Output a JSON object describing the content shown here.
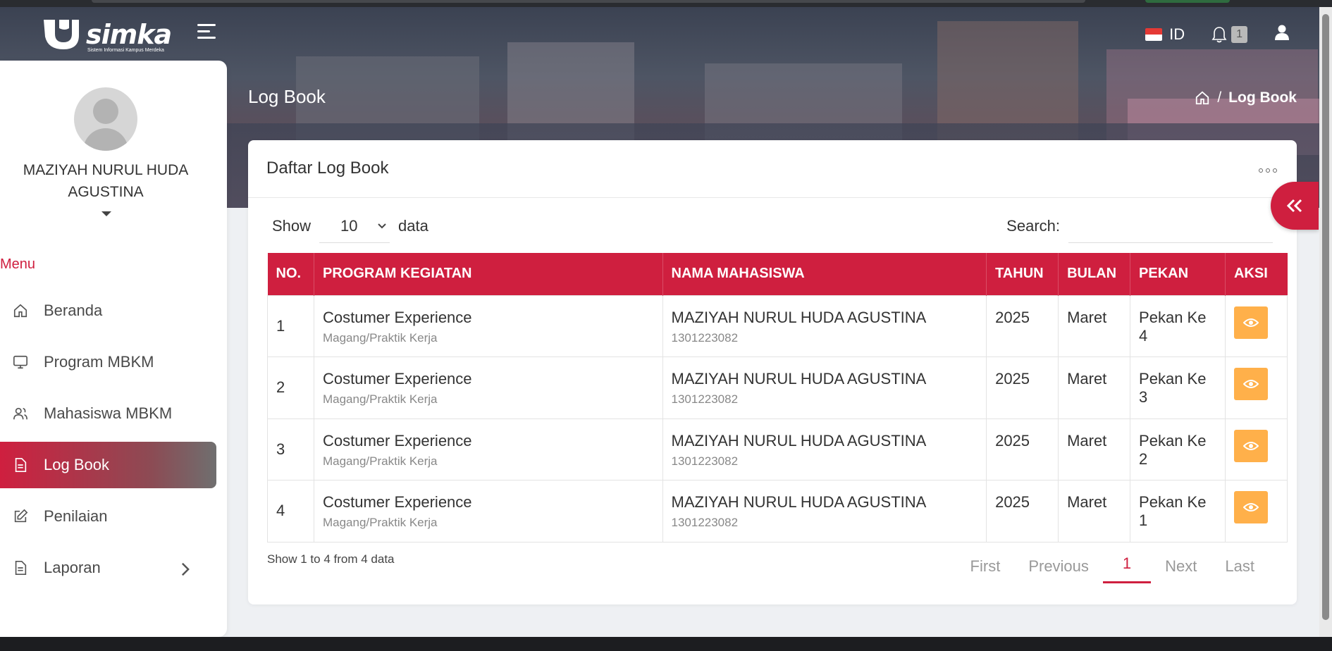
{
  "brand": {
    "name": "simka",
    "tagline": "Sistem Informasi Kampus Merdeka"
  },
  "topbar": {
    "language": "ID",
    "notification_count": "1"
  },
  "page": {
    "title": "Log Book",
    "breadcrumb": "Log Book"
  },
  "user": {
    "name": "MAZIYAH NURUL HUDA AGUSTINA"
  },
  "sidebar": {
    "menu_title": "Menu",
    "items": [
      {
        "label": "Beranda",
        "icon": "home-icon"
      },
      {
        "label": "Program MBKM",
        "icon": "monitor-icon"
      },
      {
        "label": "Mahasiswa MBKM",
        "icon": "users-icon"
      },
      {
        "label": "Log Book",
        "icon": "document-icon",
        "active": true
      },
      {
        "label": "Penilaian",
        "icon": "edit-icon"
      },
      {
        "label": "Laporan",
        "icon": "document-icon"
      }
    ]
  },
  "card": {
    "title": "Daftar Log Book"
  },
  "controls": {
    "show_label": "Show",
    "page_size": "10",
    "data_label": "data",
    "search_label": "Search:"
  },
  "table": {
    "columns": [
      "NO.",
      "PROGRAM KEGIATAN",
      "NAMA MAHASISWA",
      "TAHUN",
      "BULAN",
      "PEKAN",
      "AKSI"
    ],
    "rows": [
      {
        "no": "1",
        "program": "Costumer Experience",
        "program_type": "Magang/Praktik Kerja",
        "name": "MAZIYAH NURUL HUDA AGUSTINA",
        "nim": "1301223082",
        "year": "2025",
        "month": "Maret",
        "week": "Pekan Ke 4"
      },
      {
        "no": "2",
        "program": "Costumer Experience",
        "program_type": "Magang/Praktik Kerja",
        "name": "MAZIYAH NURUL HUDA AGUSTINA",
        "nim": "1301223082",
        "year": "2025",
        "month": "Maret",
        "week": "Pekan Ke 3"
      },
      {
        "no": "3",
        "program": "Costumer Experience",
        "program_type": "Magang/Praktik Kerja",
        "name": "MAZIYAH NURUL HUDA AGUSTINA",
        "nim": "1301223082",
        "year": "2025",
        "month": "Maret",
        "week": "Pekan Ke 2"
      },
      {
        "no": "4",
        "program": "Costumer Experience",
        "program_type": "Magang/Praktik Kerja",
        "name": "MAZIYAH NURUL HUDA AGUSTINA",
        "nim": "1301223082",
        "year": "2025",
        "month": "Maret",
        "week": "Pekan Ke 1"
      }
    ]
  },
  "footer": {
    "info": "Show 1 to 4 from 4 data"
  },
  "pagination": {
    "first": "First",
    "previous": "Previous",
    "current": "1",
    "next": "Next",
    "last": "Last"
  },
  "colors": {
    "accent": "#cf1f3f",
    "action": "#ffb04a"
  }
}
